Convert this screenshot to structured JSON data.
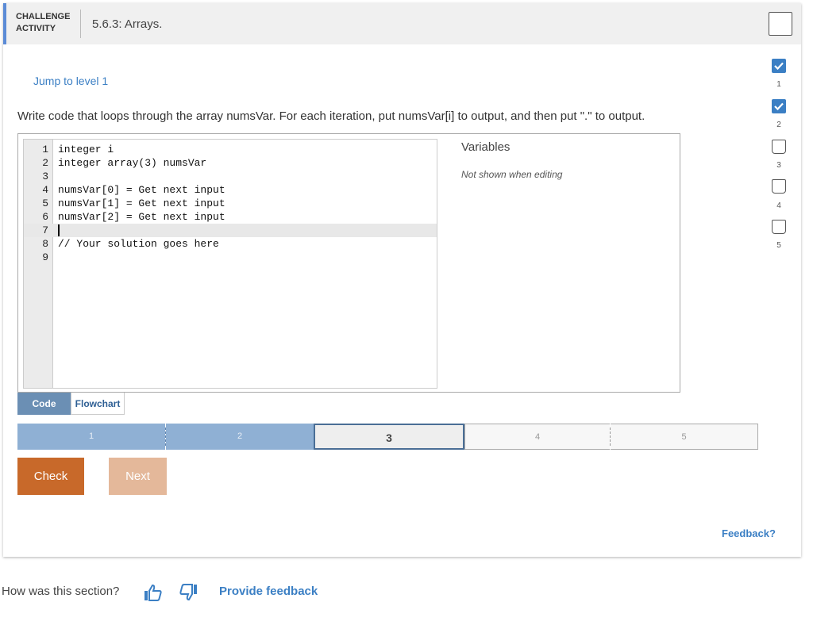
{
  "header": {
    "label_line1": "CHALLENGE",
    "label_line2": "ACTIVITY",
    "title": "5.6.3: Arrays."
  },
  "jump_link": "Jump to level 1",
  "prompt": "Write code that loops through the array numsVar. For each iteration, put numsVar[i] to output, and then put \".\" to output.",
  "editor": {
    "lines": [
      {
        "num": "1",
        "code": "integer i"
      },
      {
        "num": "2",
        "code": "integer array(3) numsVar"
      },
      {
        "num": "3",
        "code": ""
      },
      {
        "num": "4",
        "code": "numsVar[0] = Get next input"
      },
      {
        "num": "5",
        "code": "numsVar[1] = Get next input"
      },
      {
        "num": "6",
        "code": "numsVar[2] = Get next input"
      },
      {
        "num": "7",
        "code": ""
      },
      {
        "num": "8",
        "code": "// Your solution goes here"
      },
      {
        "num": "9",
        "code": ""
      }
    ],
    "active_line": 7
  },
  "variables": {
    "title": "Variables",
    "note": "Not shown when editing"
  },
  "tabs": [
    {
      "label": "Code",
      "selected": true
    },
    {
      "label": "Flowchart",
      "selected": false
    }
  ],
  "levels": [
    {
      "label": "1",
      "state": "done"
    },
    {
      "label": "2",
      "state": "done"
    },
    {
      "label": "3",
      "state": "current"
    },
    {
      "label": "4",
      "state": "future"
    },
    {
      "label": "5",
      "state": "future"
    }
  ],
  "buttons": {
    "check": "Check",
    "next": "Next"
  },
  "feedback_link": "Feedback?",
  "side_levels": [
    {
      "num": "1",
      "completed": true
    },
    {
      "num": "2",
      "completed": true
    },
    {
      "num": "3",
      "completed": false
    },
    {
      "num": "4",
      "completed": false
    },
    {
      "num": "5",
      "completed": false
    }
  ],
  "bottom": {
    "question": "How was this section?",
    "provide_feedback": "Provide feedback"
  },
  "colors": {
    "accent": "#3b7fc4",
    "check_button": "#c8692a",
    "next_button": "#e4b89a",
    "level_done": "#8fb0d4"
  }
}
